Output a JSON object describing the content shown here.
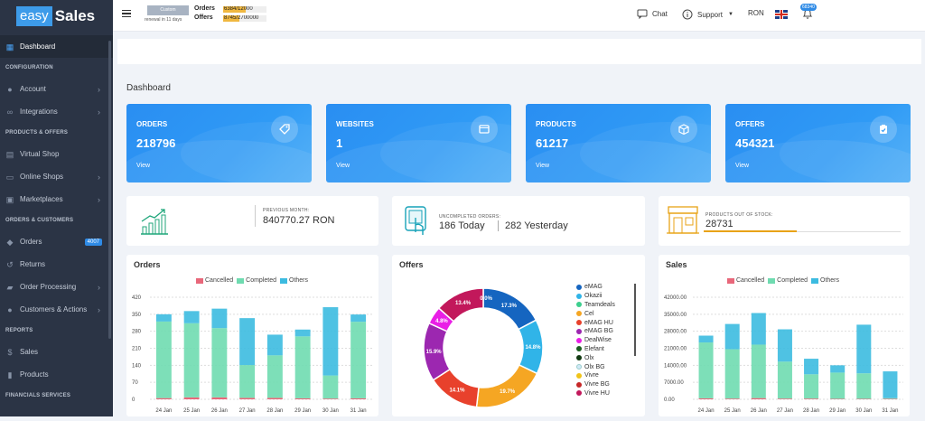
{
  "brand": {
    "easy": "easy",
    "sales": "Sales"
  },
  "sidebar": {
    "dashboard": "Dashboard",
    "sections": {
      "configuration": "CONFIGURATION",
      "products_offers": "PRODUCTS & OFFERS",
      "orders_customers": "ORDERS & CUSTOMERS",
      "reports": "REPORTS",
      "financials": "FINANCIALS SERVICES"
    },
    "items": {
      "account": "Account",
      "integrations": "Integrations",
      "virtual_shop": "Virtual Shop",
      "online_shops": "Online Shops",
      "marketplaces": "Marketplaces",
      "orders": "Orders",
      "orders_badge": "4007",
      "returns": "Returns",
      "order_processing": "Order Processing",
      "customers": "Customers & Actions",
      "sales": "Sales",
      "products": "Products"
    }
  },
  "topbar": {
    "plan": "Custom",
    "renewal": "renewal in 11 days",
    "orders_label": "Orders",
    "orders_usage": "6384/12000",
    "orders_fill": 0.53,
    "offers_label": "Offers",
    "offers_usage": "8745/2700000",
    "offers_fill": 0.37,
    "chat": "Chat",
    "support": "Support",
    "currency": "RON",
    "notif_badge": "68340"
  },
  "page_title": "Dashboard",
  "stats": [
    {
      "label": "ORDERS",
      "value": "218796",
      "view": "View",
      "icon": "tag-icon"
    },
    {
      "label": "WEBSITES",
      "value": "1",
      "view": "View",
      "icon": "browser-icon"
    },
    {
      "label": "PRODUCTS",
      "value": "61217",
      "view": "View",
      "icon": "box-icon"
    },
    {
      "label": "OFFERS",
      "value": "454321",
      "view": "View",
      "icon": "clipboard-icon"
    }
  ],
  "summary": {
    "prev_month_label": "PREVIOUS MONTH:",
    "prev_month_value": "840770.27 RON",
    "uncompleted_label": "UNCOMPLETED ORDERS:",
    "today": "186 Today",
    "yesterday": "282 Yesterday",
    "stock_label": "PRODUCTS OUT OF STOCK:",
    "stock_value": "28731"
  },
  "colors": {
    "cancelled": "#e8677a",
    "completed": "#6fdbb0",
    "others": "#3cbbe0",
    "primary": "#2f8be6"
  },
  "chart_data": [
    {
      "type": "bar",
      "title": "Orders",
      "stacked": true,
      "categories": [
        "24 Jan",
        "25 Jan",
        "26 Jan",
        "27 Jan",
        "28 Jan",
        "29 Jan",
        "30 Jan",
        "31 Jan"
      ],
      "yticks": [
        "420",
        "350",
        "280",
        "210",
        "140",
        "70",
        "0"
      ],
      "ylim": [
        0,
        420
      ],
      "series": [
        {
          "name": "Cancelled",
          "values": [
            5,
            8,
            8,
            6,
            6,
            4,
            3,
            4
          ]
        },
        {
          "name": "Completed",
          "values": [
            315,
            305,
            285,
            135,
            175,
            255,
            95,
            315
          ]
        },
        {
          "name": "Others",
          "values": [
            30,
            50,
            80,
            193,
            85,
            28,
            281,
            30
          ]
        }
      ],
      "legend": "top"
    },
    {
      "type": "pie",
      "title": "Offers",
      "donut": true,
      "labels": [
        "eMAG",
        "Okazii",
        "Teamdeals",
        "Cel",
        "eMAG HU",
        "eMAG BG",
        "DealWise",
        "Elefant",
        "Olx",
        "Olx BG",
        "Vivre",
        "Vivre BG",
        "Vivre HU"
      ],
      "values": [
        17.3,
        14.8,
        0,
        19.7,
        14.1,
        15.9,
        4.8,
        0,
        0,
        0,
        0,
        0,
        13.4
      ],
      "slice_labels": [
        "17.3%",
        "14.8%",
        "19.7%",
        "14.1%",
        "15.9%",
        "4.8%",
        "13.4%",
        "0.0%"
      ],
      "colors": [
        "#1565c0",
        "#30b4e8",
        "#3ccf8e",
        "#f5a623",
        "#e8412c",
        "#9c27b0",
        "#e91ee6",
        "#1b5e20",
        "#123a12",
        "#cfe8f6",
        "#f0c419",
        "#c62828",
        "#c2185b"
      ]
    },
    {
      "type": "bar",
      "title": "Sales",
      "stacked": true,
      "categories": [
        "24 Jan",
        "25 Jan",
        "26 Jan",
        "27 Jan",
        "28 Jan",
        "29 Jan",
        "30 Jan",
        "31 Jan"
      ],
      "yticks": [
        "42000.00",
        "35000.00",
        "28000.00",
        "21000.00",
        "14000.00",
        "7000.00",
        "0.00"
      ],
      "ylim": [
        0,
        42000
      ],
      "series": [
        {
          "name": "Cancelled",
          "values": [
            400,
            300,
            500,
            300,
            300,
            200,
            200,
            200
          ]
        },
        {
          "name": "Completed",
          "values": [
            23000,
            20300,
            22000,
            15200,
            10000,
            10800,
            10500,
            300
          ]
        },
        {
          "name": "Others",
          "values": [
            2800,
            10400,
            13000,
            13300,
            6400,
            3000,
            20000,
            11000
          ]
        }
      ],
      "legend": "top"
    }
  ]
}
